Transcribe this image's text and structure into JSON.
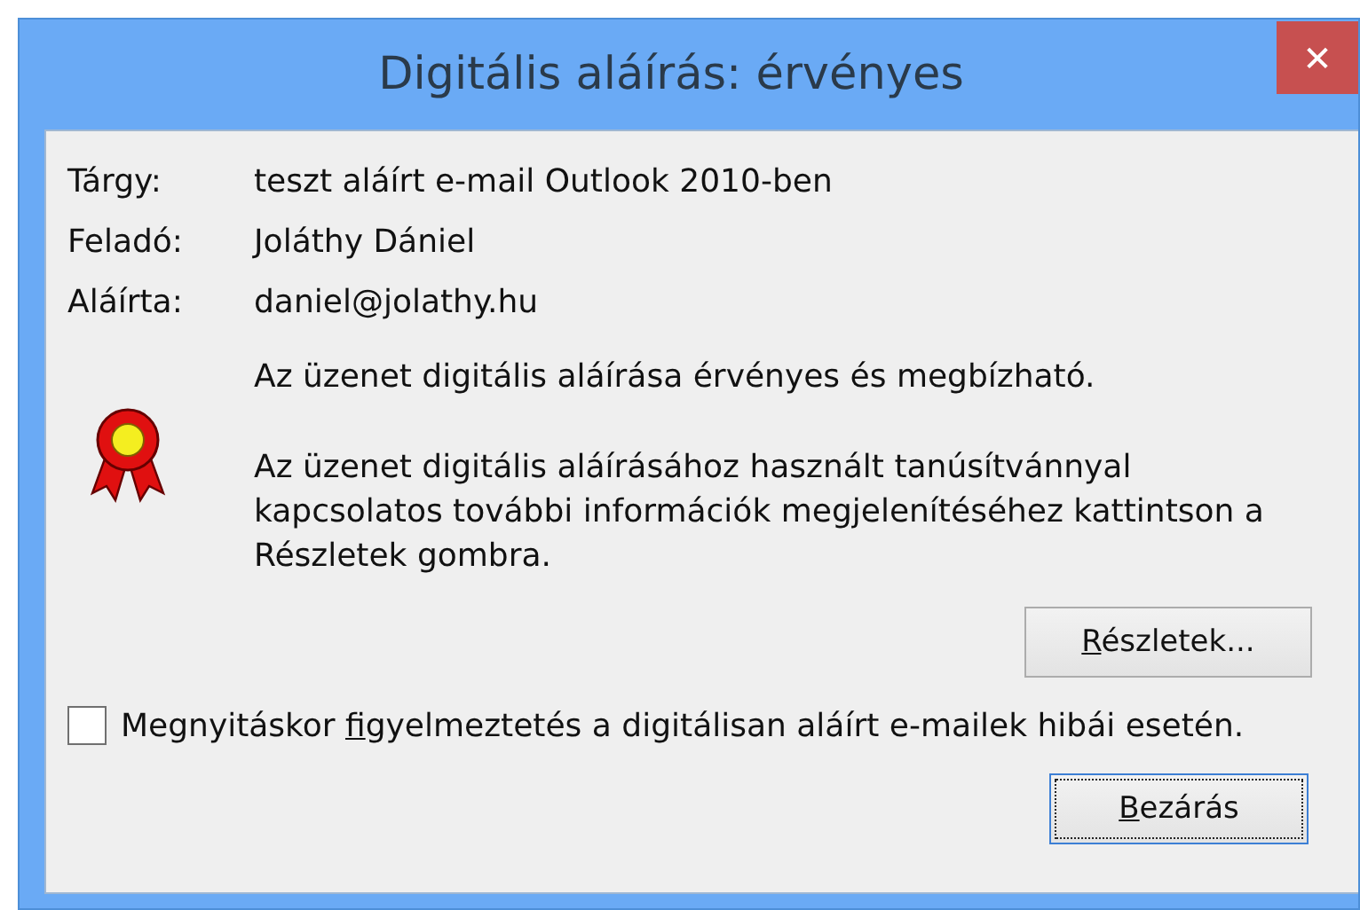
{
  "window": {
    "title": "Digitális aláírás: érvényes",
    "close": "✕"
  },
  "fields": [
    {
      "label": "Tárgy:",
      "value": "teszt aláírt e-mail Outlook 2010-ben"
    },
    {
      "label": "Feladó:",
      "value": "Joláthy Dániel"
    },
    {
      "label": "Aláírta:",
      "value": "daniel@jolathy.hu"
    }
  ],
  "messages": [
    "Az üzenet digitális aláírása érvényes és megbízható.",
    "Az üzenet digitális aláírásához használt tanúsítvánnyal kapcsolatos további információk megjelenítéséhez kattintson a Részletek gombra."
  ],
  "details_button": {
    "label": [
      {
        "text": "R",
        "underlined": true
      },
      {
        "text": "észletek...",
        "underlined": false
      }
    ]
  },
  "warn_checkbox": {
    "label": [
      {
        "text": "Megnyitáskor ",
        "underlined": false
      },
      {
        "text": "f",
        "underlined": true
      },
      {
        "text": "igyelmeztetés a digitálisan aláírt e-mailek hibái esetén.",
        "underlined": false
      }
    ],
    "checked": false
  },
  "close_button": {
    "label": [
      {
        "text": "B",
        "underlined": true
      },
      {
        "text": "ezárás",
        "underlined": false
      }
    ],
    "focused": true
  }
}
